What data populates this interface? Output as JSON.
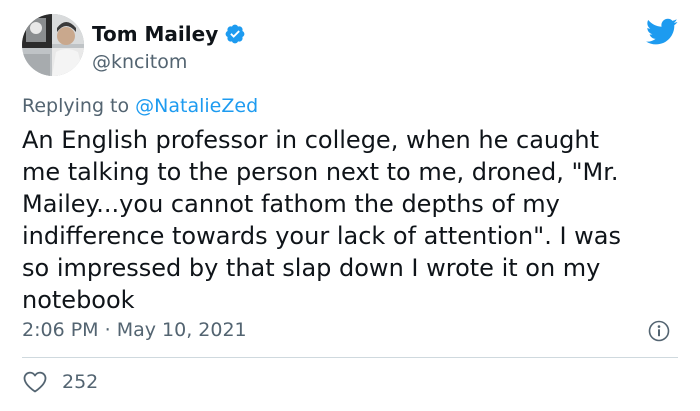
{
  "author": {
    "display_name": "Tom Mailey",
    "handle": "@kncitom",
    "verified": true
  },
  "reply": {
    "prefix": "Replying to",
    "to_handle": "@NatalieZed"
  },
  "tweet": {
    "text": "An English professor in college, when he caught\nme talking to the person next to me, droned, \"Mr.\nMailey...you cannot fathom the depths of my\nindifference towards your lack of attention\". I was\nso impressed by that slap down I wrote it on my\nnotebook",
    "time": "2:06 PM",
    "separator": "·",
    "date": "May 10, 2021"
  },
  "engagement": {
    "likes": "252"
  },
  "icons": {
    "brand": "twitter-bird-icon",
    "verified": "verified-badge-icon",
    "info": "info-icon",
    "like": "heart-icon"
  },
  "colors": {
    "brand_blue": "#1d9bf0",
    "text": "#0f1419",
    "secondary_text": "#536471",
    "divider": "#cfd9de"
  }
}
